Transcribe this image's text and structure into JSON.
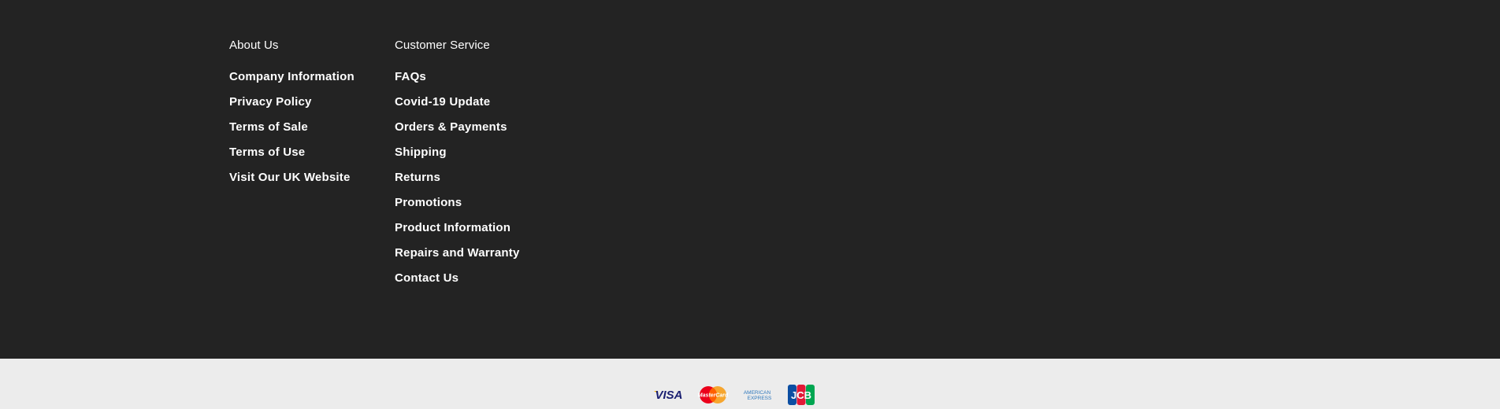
{
  "footer": {
    "about": {
      "heading": "About Us",
      "links": [
        "Company Information",
        "Privacy Policy",
        "Terms of Sale",
        "Terms of Use",
        "Visit Our UK Website"
      ]
    },
    "customer_service": {
      "heading": "Customer Service",
      "links": [
        "FAQs",
        "Covid-19 Update",
        "Orders & Payments",
        "Shipping",
        "Returns",
        "Promotions",
        "Product Information",
        "Repairs and Warranty",
        "Contact Us"
      ]
    }
  },
  "payments": {
    "icons": [
      "visa-icon",
      "mastercard-icon",
      "american-express-icon",
      "jcb-icon"
    ],
    "visa_text": "VISA",
    "mastercard_text": "MasterCard",
    "amex_line1": "AMERICAN",
    "amex_line2": "EXPRESS",
    "jcb_text": "JCB"
  },
  "colors": {
    "footer_bg": "#232323",
    "bottom_bg": "#ececec",
    "link": "#ffffff",
    "visa_blue": "#1a1f71",
    "visa_gold": "#f7b600",
    "mc_red": "#eb001b",
    "mc_orange": "#f79e1b",
    "amex_blue": "#2e77bc",
    "jcb_blue": "#0b4ea2",
    "jcb_red": "#e21836",
    "jcb_green": "#00a651"
  }
}
